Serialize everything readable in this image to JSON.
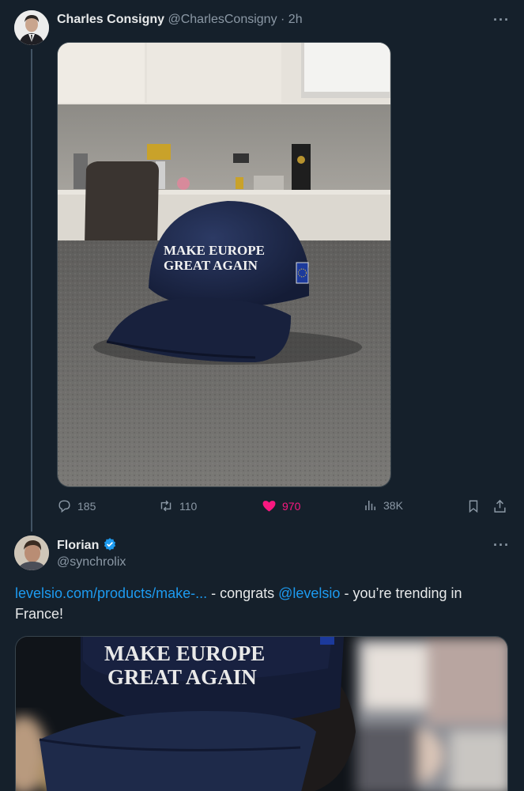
{
  "tweet1": {
    "display_name": "Charles Consigny",
    "handle": "@CharlesConsigny",
    "separator": "·",
    "time": "2h",
    "more_label": "···",
    "image_cap_text_line1": "MAKE EUROPE",
    "image_cap_text_line2": "GREAT AGAIN",
    "stats": {
      "replies": "185",
      "reposts": "110",
      "likes": "970",
      "views": "38K"
    }
  },
  "tweet2": {
    "display_name": "Florian",
    "handle": "@synchrolix",
    "more_label": "···",
    "text": {
      "link": "levelsio.com/products/make-...",
      "middle": " - congrats ",
      "mention": "@levelsio",
      "end": " - you’re trending in France!"
    },
    "image_cap_text_line1": "MAKE EUROPE",
    "image_cap_text_line2": "GREAT AGAIN"
  },
  "colors": {
    "background": "#15202b",
    "text": "#e7e9ea",
    "muted": "#8b98a5",
    "link": "#1d9bf0",
    "like": "#f91880",
    "verified": "#1d9bf0"
  },
  "icons": [
    "reply-icon",
    "repost-icon",
    "like-icon",
    "views-icon",
    "bookmark-icon",
    "share-icon",
    "verified-badge-icon"
  ]
}
